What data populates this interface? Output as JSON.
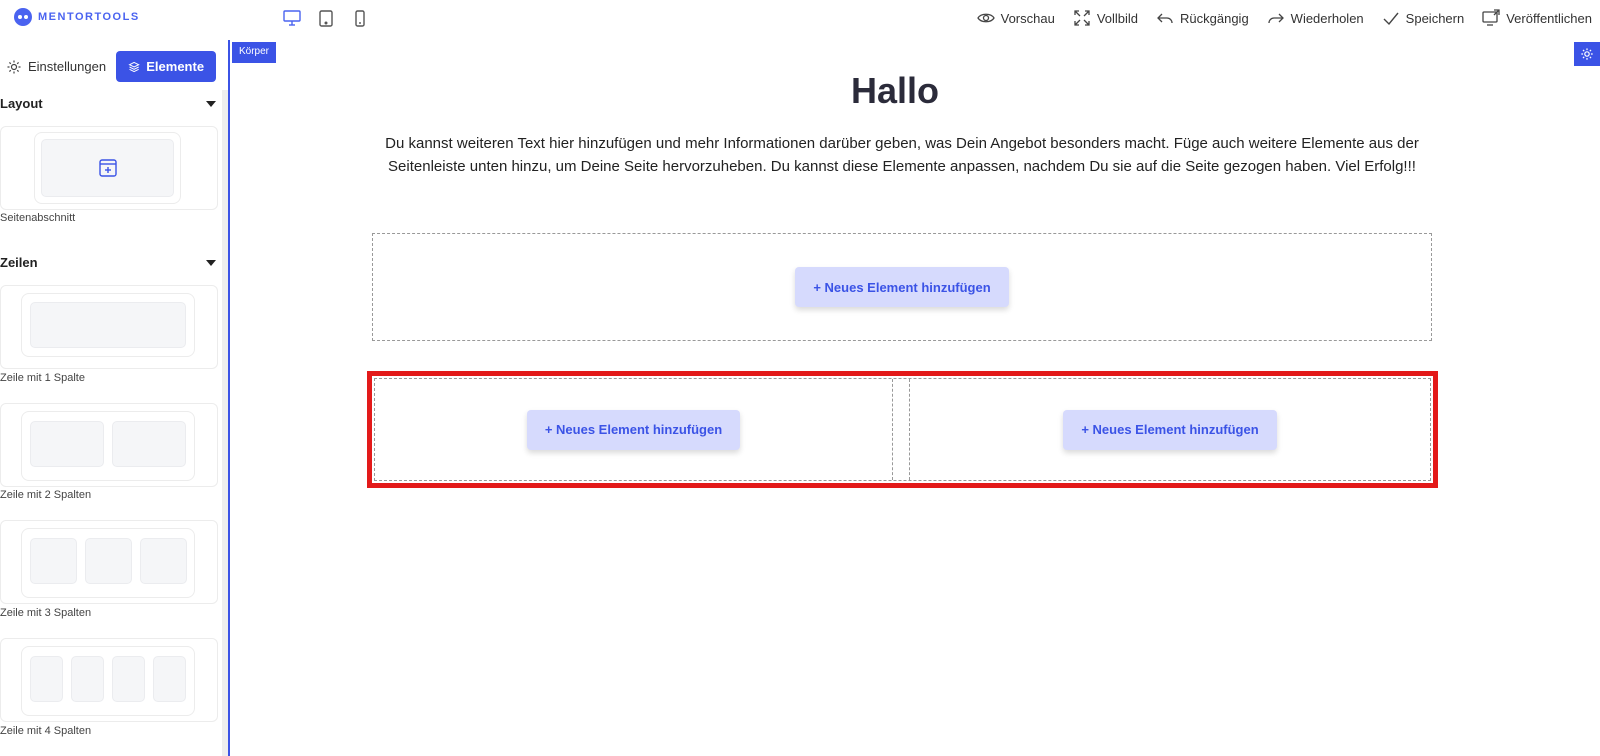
{
  "brand": {
    "name": "MENTORTOOLS"
  },
  "toolbar": {
    "preview": "Vorschau",
    "fullscreen": "Vollbild",
    "undo": "Rückgängig",
    "redo": "Wiederholen",
    "save": "Speichern",
    "publish": "Veröffentlichen"
  },
  "sidebar": {
    "tab_settings": "Einstellungen",
    "tab_elements": "Elemente",
    "section_layout": "Layout",
    "section_rows": "Zeilen",
    "items": [
      {
        "label": "Seitenabschnitt"
      },
      {
        "label": "Zeile mit 1 Spalte"
      },
      {
        "label": "Zeile mit 2 Spalten"
      },
      {
        "label": "Zeile mit 3 Spalten"
      },
      {
        "label": "Zeile mit 4 Spalten"
      }
    ]
  },
  "canvas": {
    "body_tag": "Körper",
    "headline": "Hallo",
    "paragraph": "Du kannst weiteren Text hier hinzufügen und mehr Informationen darüber geben, was Dein Angebot besonders macht. Füge auch weitere Elemente aus der Seitenleiste unten hinzu, um Deine Seite hervorzuheben. Du kannst diese Elemente anpassen, nachdem Du sie auf die Seite gezogen haben. Viel Erfolg!!!",
    "add_element": "+ Neues Element hinzufügen"
  },
  "colors": {
    "accent": "#3b53e6",
    "highlight": "#e31a1a",
    "button_bg": "#d6dafd"
  }
}
